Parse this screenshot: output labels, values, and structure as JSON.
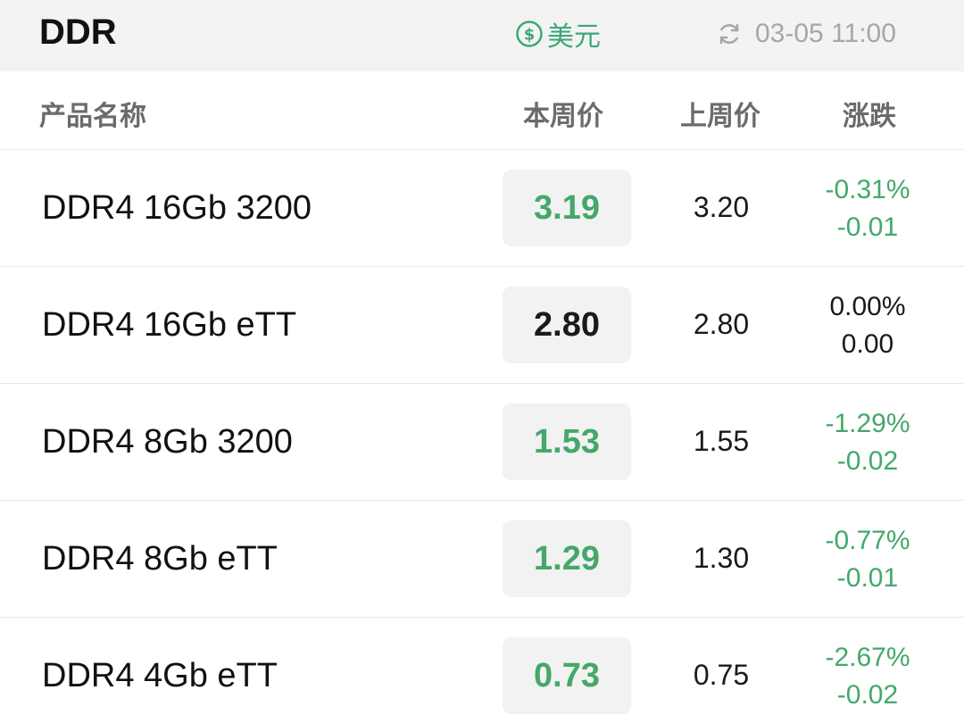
{
  "header": {
    "title": "DDR",
    "currency_label": "美元",
    "currency_icon": "dollar-circle-icon",
    "refresh_icon": "refresh-icon",
    "timestamp": "03-05 11:00"
  },
  "columns": {
    "name": "产品名称",
    "current": "本周价",
    "previous": "上周价",
    "change": "涨跌"
  },
  "colors": {
    "down": "#44a86a",
    "flat": "#1a1a1a",
    "accent": "#3aa874"
  },
  "rows": [
    {
      "name": "DDR4 16Gb 3200",
      "current": "3.19",
      "previous": "3.20",
      "change_pct": "-0.31%",
      "change_abs": "-0.01",
      "trend": "down"
    },
    {
      "name": "DDR4 16Gb eTT",
      "current": "2.80",
      "previous": "2.80",
      "change_pct": "0.00%",
      "change_abs": "0.00",
      "trend": "flat"
    },
    {
      "name": "DDR4 8Gb 3200",
      "current": "1.53",
      "previous": "1.55",
      "change_pct": "-1.29%",
      "change_abs": "-0.02",
      "trend": "down"
    },
    {
      "name": "DDR4 8Gb eTT",
      "current": "1.29",
      "previous": "1.30",
      "change_pct": "-0.77%",
      "change_abs": "-0.01",
      "trend": "down"
    },
    {
      "name": "DDR4 4Gb eTT",
      "current": "0.73",
      "previous": "0.75",
      "change_pct": "-2.67%",
      "change_abs": "-0.02",
      "trend": "down"
    }
  ]
}
